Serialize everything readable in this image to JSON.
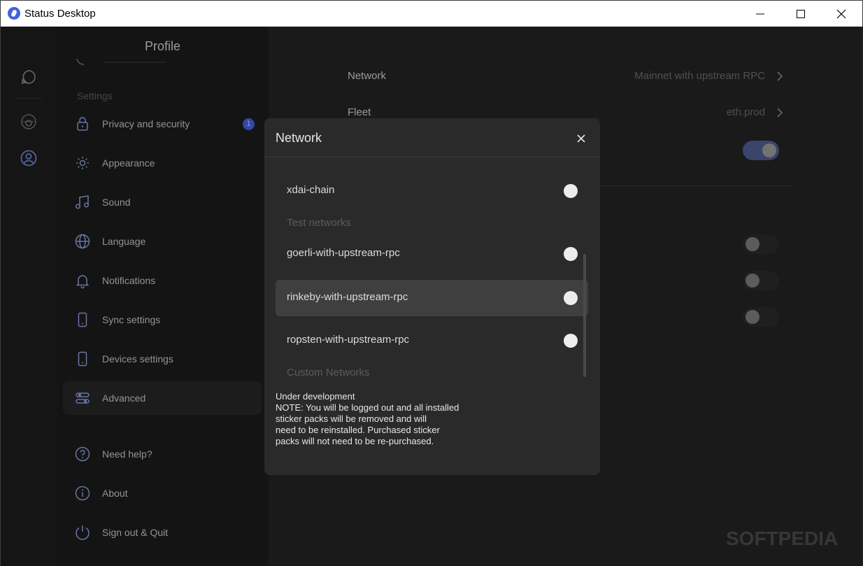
{
  "window": {
    "title": "Status Desktop",
    "controls": {
      "minimize": "minimize",
      "maximize": "maximize",
      "close": "close"
    }
  },
  "rail": {
    "icons": [
      "chat-icon",
      "wallet-icon",
      "profile-icon"
    ]
  },
  "sidebar": {
    "heading": "Profile",
    "section_label": "Settings",
    "items": [
      {
        "label": "Privacy and security",
        "icon": "lock-icon",
        "badge": "1"
      },
      {
        "label": "Appearance",
        "icon": "sun-icon"
      },
      {
        "label": "Sound",
        "icon": "music-icon"
      },
      {
        "label": "Language",
        "icon": "globe-icon"
      },
      {
        "label": "Notifications",
        "icon": "bell-icon"
      },
      {
        "label": "Sync settings",
        "icon": "phone-icon"
      },
      {
        "label": "Devices settings",
        "icon": "phone-icon"
      },
      {
        "label": "Advanced",
        "icon": "sliders-icon",
        "active": true
      },
      {
        "label": "Need help?",
        "icon": "help-icon"
      },
      {
        "label": "About",
        "icon": "info-icon"
      },
      {
        "label": "Sign out & Quit",
        "icon": "power-icon"
      }
    ]
  },
  "content": {
    "network": {
      "label": "Network",
      "value": "Mainnet with upstream RPC"
    },
    "fleet": {
      "label": "Fleet",
      "value": "eth.prod"
    },
    "toggles": [
      {
        "name": "toggle-1",
        "on": true
      },
      {
        "name": "toggle-2",
        "on": false
      },
      {
        "name": "toggle-3",
        "on": false
      },
      {
        "name": "toggle-4",
        "on": false
      }
    ]
  },
  "modal": {
    "title": "Network",
    "rows": [
      {
        "label": "xdai-chain"
      },
      {
        "label": "goerli-with-upstream-rpc"
      },
      {
        "label": "rinkeby-with-upstream-rpc",
        "hover": true
      },
      {
        "label": "ropsten-with-upstream-rpc"
      }
    ],
    "groups": {
      "test": "Test networks",
      "custom": "Custom Networks"
    },
    "note": "Under development\nNOTE: You will be logged out and all installed\nsticker packs will be removed and will\nneed to be reinstalled. Purchased sticker\npacks will not need to be re-purchased."
  },
  "watermark": "SOFTPEDIA",
  "colors": {
    "accent": "#4360df",
    "background": "#171717",
    "modal": "#2a2a2a"
  }
}
